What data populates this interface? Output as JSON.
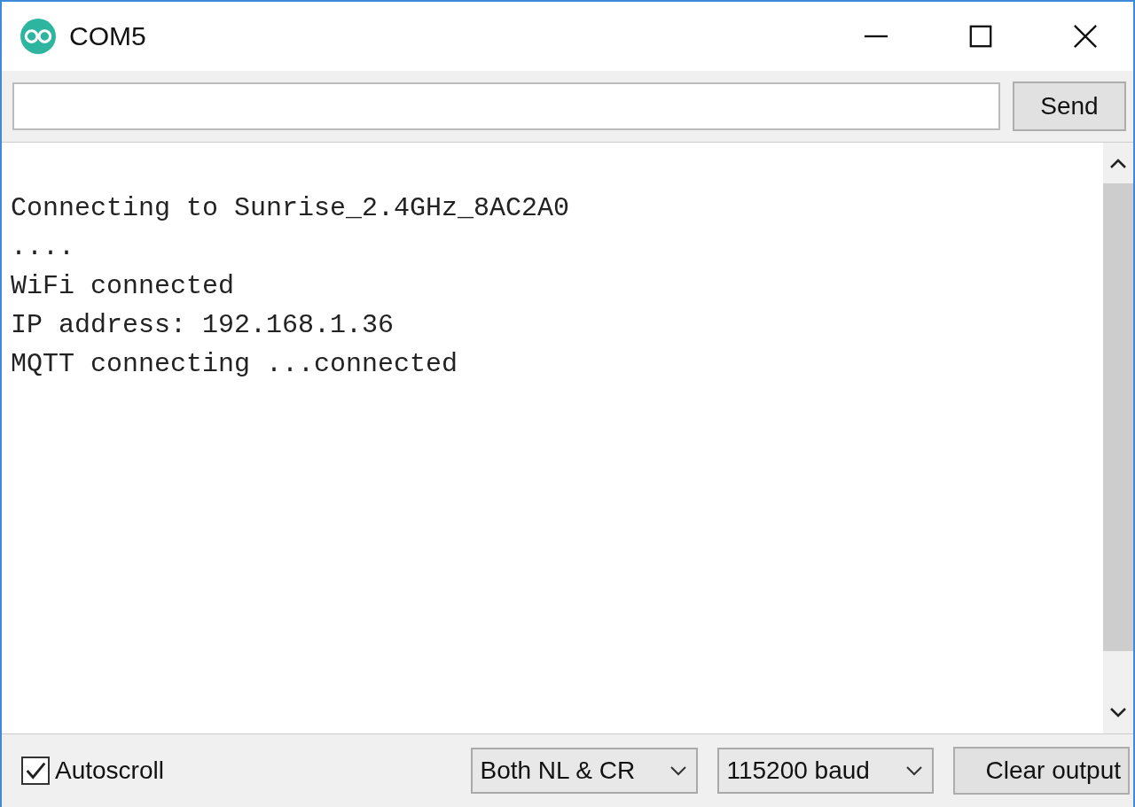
{
  "window": {
    "title": "COM5"
  },
  "send_button": "Send",
  "output_lines": [
    "Connecting to Sunrise_2.4GHz_8AC2A0",
    "....",
    "WiFi connected",
    "IP address: 192.168.1.36",
    "MQTT connecting ...connected"
  ],
  "autoscroll": {
    "label": "Autoscroll",
    "checked": true
  },
  "line_ending": {
    "value": "Both NL & CR"
  },
  "baud": {
    "value": "115200 baud"
  },
  "clear_button": "Clear output"
}
